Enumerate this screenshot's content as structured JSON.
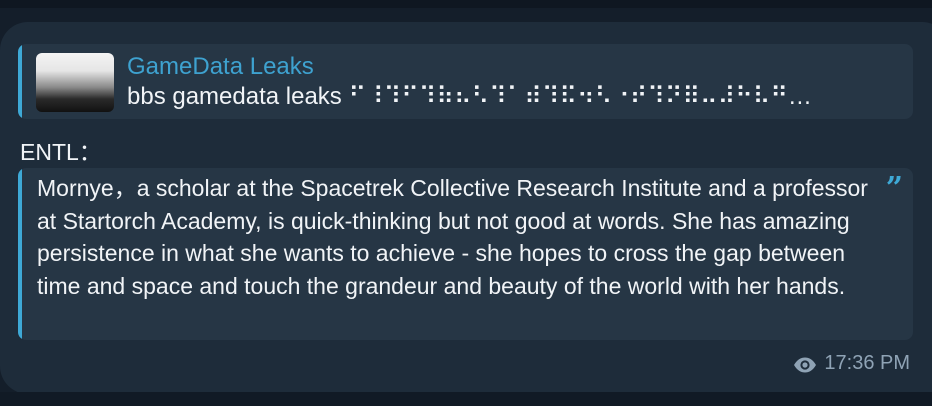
{
  "reply": {
    "title": "GameData Leaks",
    "text": "bbs gamedata leaks ⠋⠸⠹⠋⠹⠷⠦⠣⠹⠁⠾⠹⠯⠲⠣⠐⠞⠹⠝⠿⠤⠼⠓⠧⠛…"
  },
  "message": {
    "sender": "ENTL：",
    "quote": "Mornye，a scholar at the Spacetrek Collective Research Institute and a professor at Startorch Academy, is quick-thinking but not good at words. She has amazing persistence in what she wants to achieve - she hopes to cross the gap between time and space and touch the grandeur and beauty of the world with her hands.",
    "time": "17:36 PM"
  },
  "colors": {
    "accent": "#3ea9d6",
    "bubble": "#1e2c3a",
    "quote_bg": "#263645"
  },
  "icons": {
    "views": "eye-icon",
    "quote": "quote-icon"
  }
}
